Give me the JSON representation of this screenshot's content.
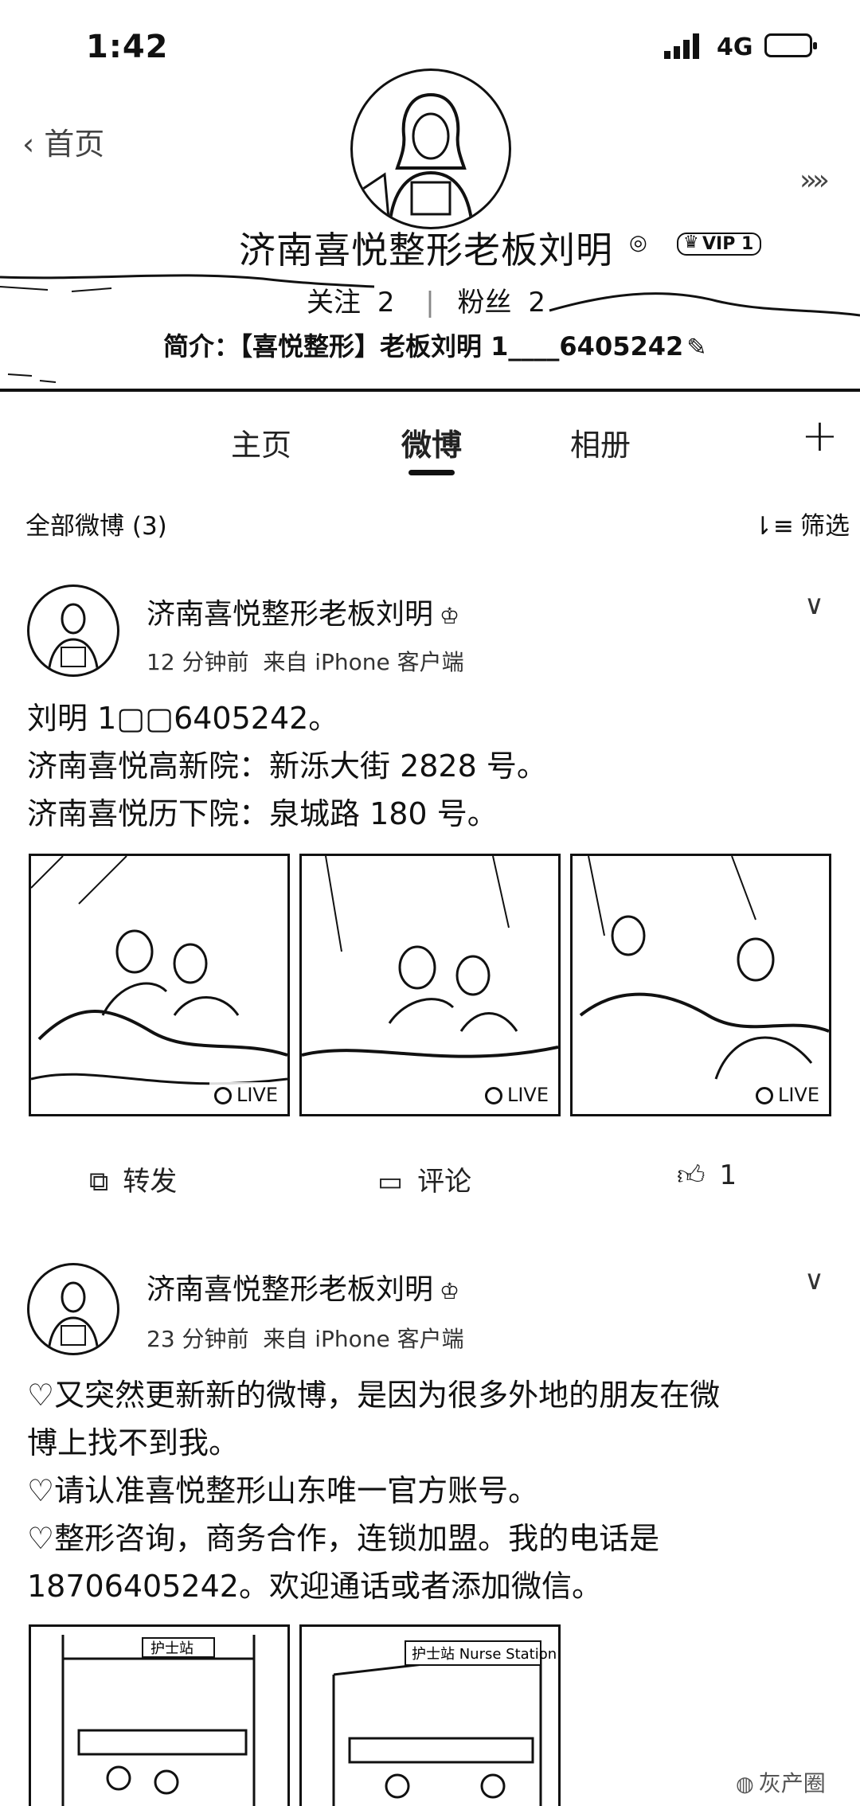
{
  "status_bar": {
    "time": "1:42",
    "network": "4G"
  },
  "header": {
    "back_label": "‹ 首页",
    "more_label": "»»",
    "name": "济南喜悦整形老板刘明",
    "badge_icon": "verified-badge-icon",
    "vip_label": "VIP 1",
    "following_label": "关注",
    "following_count": "2",
    "followers_label": "粉丝",
    "followers_count": "2",
    "bio": "简介：【喜悦整形】老板刘明 1____6405242"
  },
  "tabs": [
    {
      "label": "主页",
      "active": false
    },
    {
      "label": "微博",
      "active": true
    },
    {
      "label": "相册",
      "active": false
    }
  ],
  "plus_label": "+",
  "list_header": {
    "count_label": "全部微博 (3)",
    "filter_label": "筛选"
  },
  "posts": [
    {
      "author": "济南喜悦整形老板刘明",
      "time": "12 分钟前",
      "source": "来自 iPhone 客户端",
      "lines": [
        "刘明 1▢▢6405242。",
        " 济南喜悦高新院：新泺大街 2828 号。",
        " 济南喜悦历下院：泉城路 180 号。"
      ],
      "images": [
        {
          "live_label": "LIVE"
        },
        {
          "live_label": "LIVE"
        },
        {
          "live_label": "LIVE"
        }
      ],
      "actions": {
        "repost": "转发",
        "comment": "评论",
        "like_count": "1"
      }
    },
    {
      "author": "济南喜悦整形老板刘明",
      "time": "23 分钟前",
      "source": "来自 iPhone 客户端",
      "lines": [
        "♡又突然更新新的微博，是因为很多外地的朋友在微",
        "博上找不到我。",
        "♡请认准喜悦整形山东唯一官方账号。",
        "♡整形咨询，商务合作，连锁加盟。我的电话是",
        "18706405242。欢迎通话或者添加微信。"
      ],
      "images": [
        {
          "sign_text": "护士站"
        },
        {
          "sign_text": "护士站 Nurse Station"
        }
      ]
    }
  ],
  "watermark": "灰产圈"
}
